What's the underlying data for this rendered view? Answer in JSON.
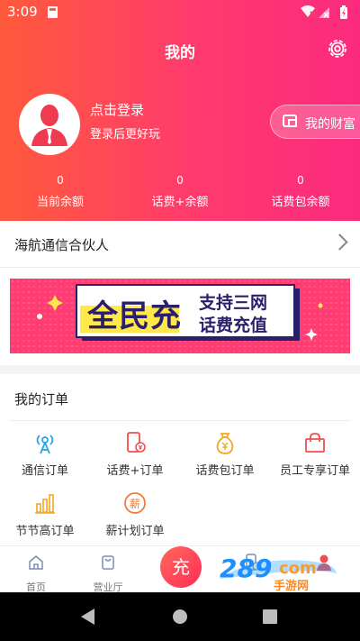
{
  "status_bar": {
    "time": "3:09"
  },
  "header": {
    "title": "我的"
  },
  "profile": {
    "login_title": "点击登录",
    "login_subtitle": "登录后更好玩",
    "wealth_button": "我的财富"
  },
  "stats": [
    {
      "value": "0",
      "label": "当前余额"
    },
    {
      "value": "0",
      "label": "话费+余额"
    },
    {
      "value": "0",
      "label": "话费包余额"
    }
  ],
  "partner": {
    "label": "海航通信合伙人"
  },
  "banner": {
    "main_text": "全民充",
    "line1": "支持三网",
    "line2": "话费充值"
  },
  "orders": {
    "title": "我的订单",
    "items": [
      {
        "label": "通信订单",
        "icon": "signal-tower-icon"
      },
      {
        "label": "话费+订单",
        "icon": "phone-yen-icon"
      },
      {
        "label": "话费包订单",
        "icon": "money-bag-icon"
      },
      {
        "label": "员工专享订单",
        "icon": "shopping-bag-icon"
      },
      {
        "label": "节节高订单",
        "icon": "bar-chart-icon"
      },
      {
        "label": "薪计划订单",
        "icon": "salary-icon"
      }
    ]
  },
  "tabbar": {
    "tabs": [
      {
        "label": "首页",
        "icon": "home-icon"
      },
      {
        "label": "营业厅",
        "icon": "bag-icon"
      }
    ],
    "center_button": "充"
  },
  "watermark": {
    "number": "289",
    "suffix": "com",
    "label": "手游网"
  },
  "colors": {
    "primary": "#ff3a6e",
    "gradient_start": "#ff5a3c",
    "gradient_end": "#fb2a7e",
    "banner_pink": "#ff3d73",
    "banner_yellow": "#ffe94a"
  }
}
